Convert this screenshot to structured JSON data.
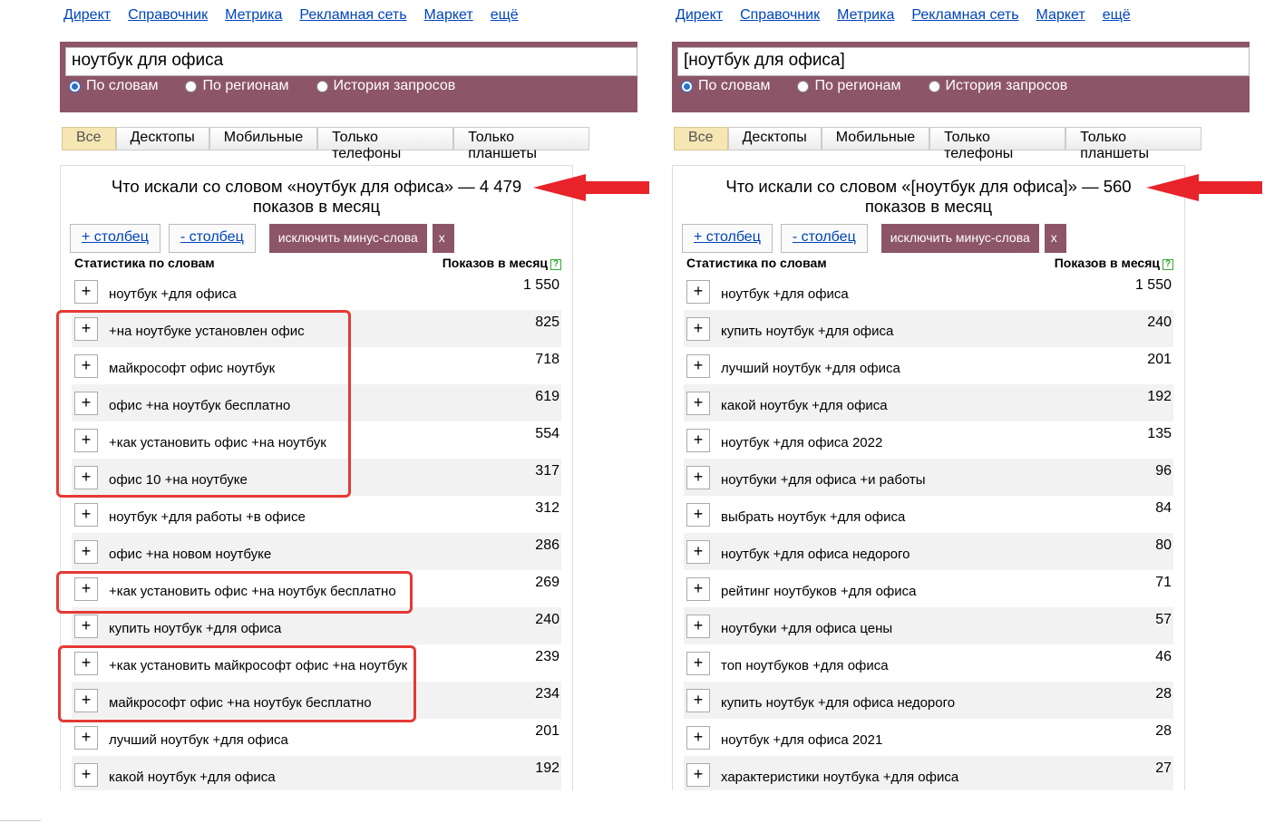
{
  "nav": [
    "Директ",
    "Справочник",
    "Метрика",
    "Рекламная сеть",
    "Маркет",
    "ещё"
  ],
  "radios": [
    "По словам",
    "По регионам",
    "История запросов"
  ],
  "tabs": [
    "Все",
    "Десктопы",
    "Мобильные",
    "Только телефоны",
    "Только планшеты"
  ],
  "controls": {
    "add_col": "+ столбец",
    "remove_col": "- столбец",
    "exclude": "исключить минус-слова",
    "close": "x"
  },
  "colhead": {
    "left": "Статистика по словам",
    "right": "Показов в месяц"
  },
  "colors": {
    "brand": "#8d5568",
    "link": "#0044bb",
    "highlight": "#e53935"
  },
  "left": {
    "query": "ноутбук для офиса",
    "headline": "Что искали со словом «ноутбук для офиса» — 4 479 показов в месяц",
    "rows": [
      {
        "kw": "ноутбук +для офиса",
        "n": "1 550"
      },
      {
        "kw": "+на ноутбуке установлен офис",
        "n": "825"
      },
      {
        "kw": "майкрософт офис ноутбук",
        "n": "718"
      },
      {
        "kw": "офис +на ноутбук бесплатно",
        "n": "619"
      },
      {
        "kw": "+как установить офис +на ноутбук",
        "n": "554"
      },
      {
        "kw": "офис 10 +на ноутбуке",
        "n": "317"
      },
      {
        "kw": "ноутбук +для работы +в офисе",
        "n": "312"
      },
      {
        "kw": "офис +на новом ноутбуке",
        "n": "286"
      },
      {
        "kw": "+как установить офис +на ноутбук бесплатно",
        "n": "269"
      },
      {
        "kw": "купить ноутбук +для офиса",
        "n": "240"
      },
      {
        "kw": "+как установить майкрософт офис +на ноутбук",
        "n": "239"
      },
      {
        "kw": "майкрософт офис +на ноутбук бесплатно",
        "n": "234"
      },
      {
        "kw": "лучший ноутбук +для офиса",
        "n": "201"
      },
      {
        "kw": "какой ноутбук +для офиса",
        "n": "192"
      }
    ]
  },
  "right": {
    "query": "[ноутбук для офиса]",
    "headline": "Что искали со словом «[ноутбук для офиса]» — 560 показов в месяц",
    "rows": [
      {
        "kw": "ноутбук +для офиса",
        "n": "1 550"
      },
      {
        "kw": "купить ноутбук +для офиса",
        "n": "240"
      },
      {
        "kw": "лучший ноутбук +для офиса",
        "n": "201"
      },
      {
        "kw": "какой ноутбук +для офиса",
        "n": "192"
      },
      {
        "kw": "ноутбук +для офиса 2022",
        "n": "135"
      },
      {
        "kw": "ноутбуки +для офиса +и работы",
        "n": "96"
      },
      {
        "kw": "выбрать ноутбук +для офиса",
        "n": "84"
      },
      {
        "kw": "ноутбук +для офиса недорого",
        "n": "80"
      },
      {
        "kw": "рейтинг ноутбуков +для офиса",
        "n": "71"
      },
      {
        "kw": "ноутбуки +для офиса цены",
        "n": "57"
      },
      {
        "kw": "топ ноутбуков +для офиса",
        "n": "46"
      },
      {
        "kw": "купить ноутбук +для офиса недорого",
        "n": "28"
      },
      {
        "kw": "ноутбук +для офиса 2021",
        "n": "28"
      },
      {
        "kw": "характеристики ноутбука +для офиса",
        "n": "27"
      }
    ]
  }
}
